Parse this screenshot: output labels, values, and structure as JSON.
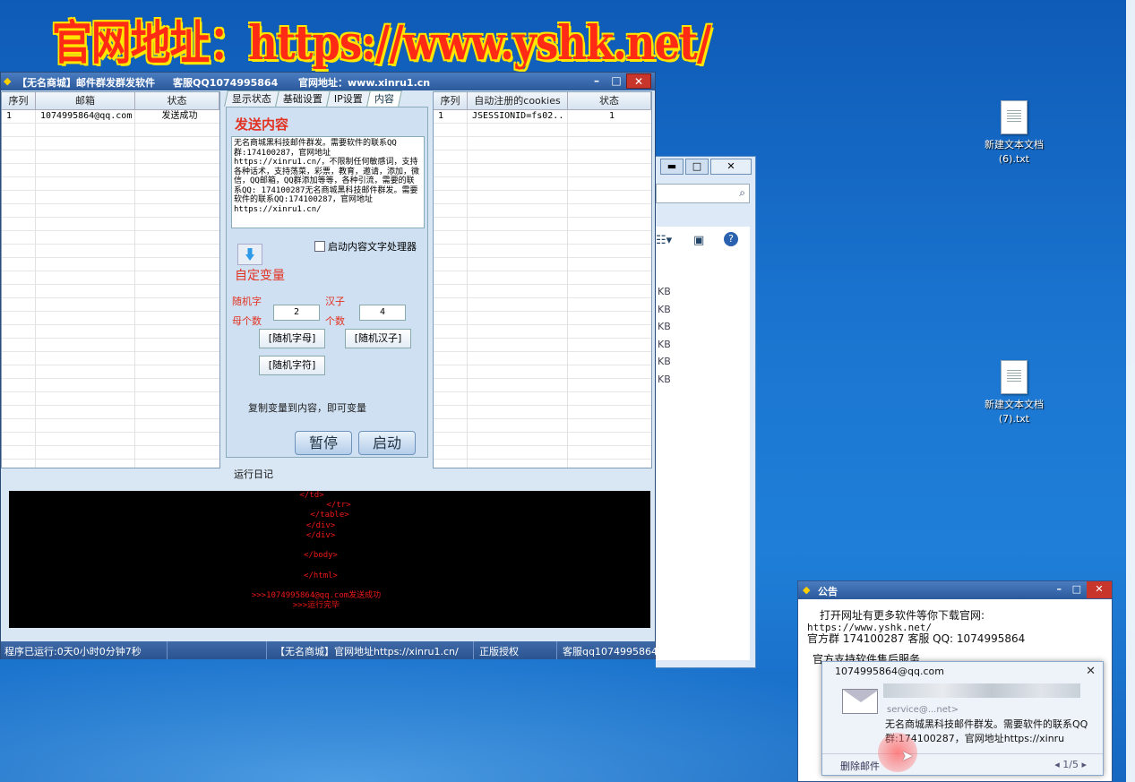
{
  "banner": "官网地址：https://www.yshk.net/",
  "desktop_icons": [
    {
      "name": "新建文本文档\n(6).txt"
    },
    {
      "name": "新建文本文档\n(7).txt"
    }
  ],
  "explorer": {
    "min": "▬",
    "max": "□",
    "close": "✕",
    "sizes": [
      "KB",
      "KB",
      "KB",
      "KB",
      "KB",
      "KB"
    ]
  },
  "app": {
    "title": "【无名商城】邮件群发群发软件",
    "support": "客服QQ1074995864",
    "site": "官网地址：www.xinru1.cn",
    "left_grid": {
      "headers": [
        "序列",
        "邮箱",
        "状态"
      ],
      "rows": [
        [
          "1",
          "1074995864@qq.com",
          "发送成功"
        ]
      ]
    },
    "tabs": [
      "显示状态",
      "基础设置",
      "IP设置",
      "内容"
    ],
    "send_content_label": "发送内容",
    "content_text": "无名商城黑科技邮件群发。需要软件的联系QQ群:174100287，官网地址https://xinru1.cn/，不限制任何敏感词，支持各种话术，支持荡菜，彩票，教育，邀请，添加，微信，QQ邮箱，QQ群添加等等，各种引流，需要的联系QQ: 174100287无名商城黑科技邮件群发。需要软件的联系QQ:174100287，官网地址https://xinru1.cn/",
    "enable_processor": "启动内容文字处理器",
    "custom_var": "自定变量",
    "rand_letters_label1": "随机字",
    "rand_letters_label2": "母个数",
    "rand_letters_value": "2",
    "hanzi_label1": "汉子",
    "hanzi_label2": "个数",
    "hanzi_value": "4",
    "btn_rand_letter": "[随机字母]",
    "btn_rand_hanzi": "[随机汉子]",
    "btn_rand_symbol": "[随机字符]",
    "copy_hint": "复制变量到内容，即可变量",
    "btn_pause": "暂停",
    "btn_start": "启动",
    "right_grid": {
      "headers": [
        "序列",
        "自动注册的cookies",
        "状态"
      ],
      "rows": [
        [
          "1",
          "JSESSIONID=fs02..",
          "1"
        ]
      ]
    },
    "log_label": "运行日记",
    "log_lines": [
      "</td>",
      "</tr>",
      "</table>",
      "</div>",
      "</div>",
      "",
      "</body>",
      "",
      "</html>",
      "",
      ">>>1074995864@qq.com发送成功",
      ">>>运行完毕"
    ],
    "status": {
      "runtime": "程序已运行:0天0小时0分钟7秒",
      "site": "【无名商城】官网地址https://xinru1.cn/",
      "license": "正版授权",
      "support": "客服qq1074995864"
    }
  },
  "notice": {
    "title": "公告",
    "line1": "打开网址有更多软件等你下载官网:",
    "line2": "https://www.yshk.net/",
    "line3": "官方群 174100287  客服 QQ: 1074995864",
    "line4": "官方支持软件售后服务"
  },
  "toast": {
    "email": "1074995864@qq.com",
    "sender": "service@...net>",
    "message": "无名商城黑科技邮件群发。需要软件的联系QQ群:174100287，官网地址https://xinru",
    "delete": "删除邮件",
    "pager": "1/5"
  }
}
